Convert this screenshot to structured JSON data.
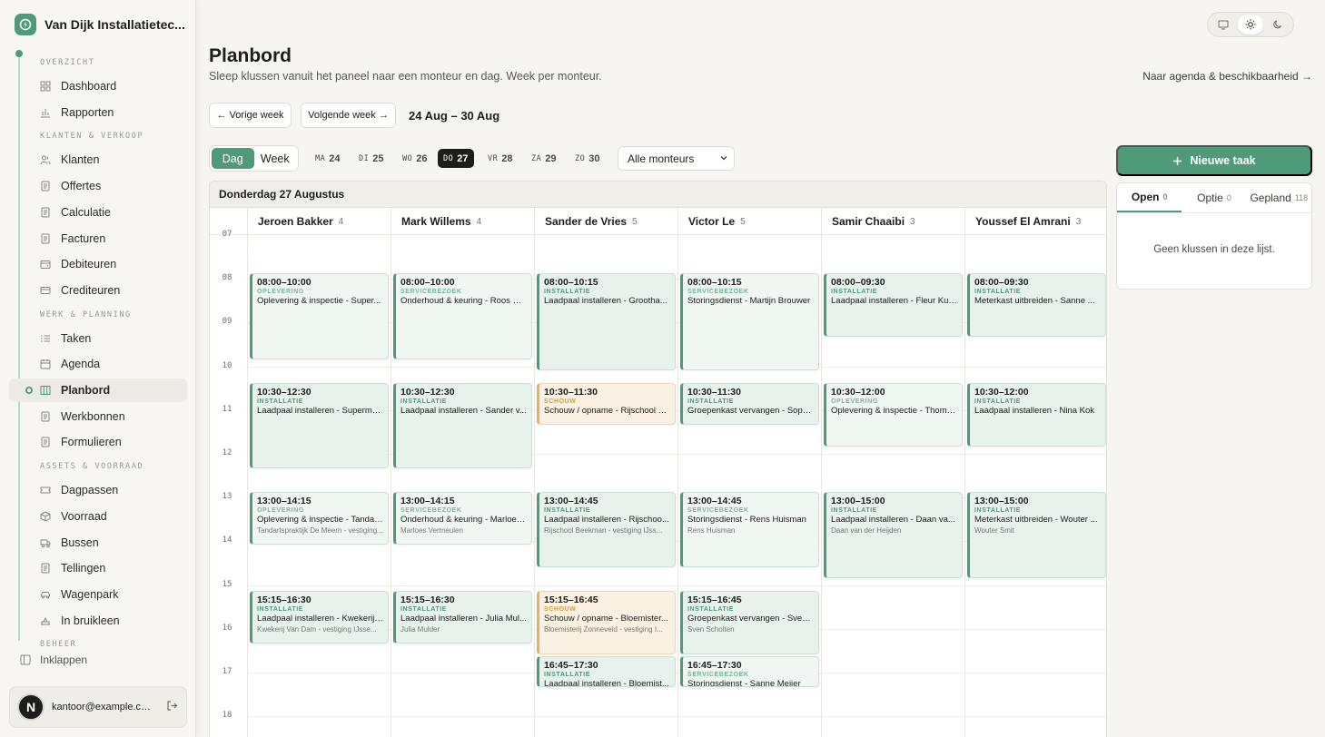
{
  "sidebar": {
    "company": "Van Dijk Installatietec...",
    "sections": [
      {
        "title": "OVERZICHT",
        "items": [
          {
            "label": "Dashboard",
            "icon": "dashboard-icon"
          },
          {
            "label": "Rapporten",
            "icon": "bar-chart-icon"
          }
        ]
      },
      {
        "title": "KLANTEN & VERKOOP",
        "items": [
          {
            "label": "Klanten",
            "icon": "users-icon"
          },
          {
            "label": "Offertes",
            "icon": "document-icon"
          },
          {
            "label": "Calculatie",
            "icon": "calculator-icon"
          },
          {
            "label": "Facturen",
            "icon": "invoice-icon"
          },
          {
            "label": "Debiteuren",
            "icon": "wallet-icon"
          },
          {
            "label": "Crediteuren",
            "icon": "card-icon"
          }
        ]
      },
      {
        "title": "WERK & PLANNING",
        "items": [
          {
            "label": "Taken",
            "icon": "list-icon"
          },
          {
            "label": "Agenda",
            "icon": "calendar-icon"
          },
          {
            "label": "Planbord",
            "icon": "columns-icon",
            "active": true
          },
          {
            "label": "Werkbonnen",
            "icon": "clipboard-icon"
          },
          {
            "label": "Formulieren",
            "icon": "form-icon"
          }
        ]
      },
      {
        "title": "ASSETS & VOORRAAD",
        "items": [
          {
            "label": "Dagpassen",
            "icon": "ticket-icon"
          },
          {
            "label": "Voorraad",
            "icon": "box-icon"
          },
          {
            "label": "Bussen",
            "icon": "van-icon"
          },
          {
            "label": "Tellingen",
            "icon": "checklist-icon"
          },
          {
            "label": "Wagenpark",
            "icon": "car-icon"
          },
          {
            "label": "In bruikleen",
            "icon": "handover-icon"
          }
        ]
      },
      {
        "title": "BEHEER",
        "items": []
      }
    ],
    "collapse_label": "Inklappen",
    "user": {
      "initial": "N",
      "email": "kantoor@example.co..."
    }
  },
  "header": {
    "title": "Planbord",
    "subtitle": "Sleep klussen vanuit het paneel naar een monteur en dag. Week per monteur.",
    "agenda_link": "Naar agenda & beschikbaarheid →"
  },
  "nav": {
    "prev": "← Vorige week",
    "next": "Volgende week →",
    "range": "24 Aug – 30 Aug"
  },
  "view_toggle": {
    "day": "Dag",
    "week": "Week"
  },
  "days": [
    {
      "name": "MA",
      "num": "24"
    },
    {
      "name": "DI",
      "num": "25"
    },
    {
      "name": "WO",
      "num": "26"
    },
    {
      "name": "DO",
      "num": "27",
      "active": true
    },
    {
      "name": "VR",
      "num": "28"
    },
    {
      "name": "ZA",
      "num": "29"
    },
    {
      "name": "ZO",
      "num": "30"
    }
  ],
  "filter": {
    "selected": "Alle monteurs"
  },
  "board": {
    "date_title": "Donderdag 27 Augustus",
    "hours": [
      "07",
      "08",
      "09",
      "10",
      "11",
      "12",
      "13",
      "14",
      "15",
      "16",
      "17",
      "18"
    ],
    "columns": [
      {
        "name": "Jeroen Bakker",
        "count": "4",
        "jobs": [
          {
            "time": "08:00–10:00",
            "start": 8,
            "end": 10,
            "type": "OPLEVERING",
            "variant": "light",
            "title": "Oplevering & inspectie - Super...",
            "sub": ""
          },
          {
            "time": "10:30–12:30",
            "start": 10.5,
            "end": 12.5,
            "type": "INSTALLATIE",
            "variant": "install",
            "title": "Laadpaal installeren - Superma...",
            "sub": ""
          },
          {
            "time": "13:00–14:15",
            "start": 13,
            "end": 14.25,
            "type": "OPLEVERING",
            "variant": "light",
            "title": "Oplevering & inspectie - Tandar...",
            "sub": "Tandartspraktijk De Meern - vestiging..."
          },
          {
            "time": "15:15–16:30",
            "start": 15.25,
            "end": 16.5,
            "type": "INSTALLATIE",
            "variant": "install",
            "title": "Laadpaal installeren - Kwekerij ...",
            "sub": "Kwekerij Van Dam - vestiging IJsse..."
          }
        ]
      },
      {
        "name": "Mark Willems",
        "count": "4",
        "jobs": [
          {
            "time": "08:00–10:00",
            "start": 8,
            "end": 10,
            "type": "SERVICEBEZOEK",
            "variant": "light",
            "title": "Onderhoud & keuring - Roos He...",
            "sub": ""
          },
          {
            "time": "10:30–12:30",
            "start": 10.5,
            "end": 12.5,
            "type": "INSTALLATIE",
            "variant": "install",
            "title": "Laadpaal installeren - Sander v...",
            "sub": ""
          },
          {
            "time": "13:00–14:15",
            "start": 13,
            "end": 14.25,
            "type": "SERVICEBEZOEK",
            "variant": "light",
            "title": "Onderhoud & keuring - Marloes...",
            "sub": "Marloes Vermeulen"
          },
          {
            "time": "15:15–16:30",
            "start": 15.25,
            "end": 16.5,
            "type": "INSTALLATIE",
            "variant": "install",
            "title": "Laadpaal installeren - Julia Mul...",
            "sub": "Julia Mulder"
          }
        ]
      },
      {
        "name": "Sander de Vries",
        "count": "5",
        "jobs": [
          {
            "time": "08:00–10:15",
            "start": 8,
            "end": 10.25,
            "type": "INSTALLATIE",
            "variant": "install",
            "title": "Laadpaal installeren - Grootha...",
            "sub": ""
          },
          {
            "time": "10:30–11:30",
            "start": 10.5,
            "end": 11.5,
            "type": "SCHOUW",
            "variant": "schouw",
            "title": "Schouw / opname - Rijschool B...",
            "sub": ""
          },
          {
            "time": "13:00–14:45",
            "start": 13,
            "end": 14.75,
            "type": "INSTALLATIE",
            "variant": "install",
            "title": "Laadpaal installeren - Rijschoo...",
            "sub": "Rijschool Beekman - vestiging IJss..."
          },
          {
            "time": "15:15–16:45",
            "start": 15.25,
            "end": 16.75,
            "type": "SCHOUW",
            "variant": "schouw",
            "title": "Schouw / opname - Bloemister...",
            "sub": "Bloemisterij Zonneveld - vestiging I..."
          },
          {
            "time": "16:45–17:30",
            "start": 16.75,
            "end": 17.5,
            "type": "INSTALLATIE",
            "variant": "install",
            "title": "Laadpaal installeren - Bloemist...",
            "sub": ""
          }
        ]
      },
      {
        "name": "Victor Le",
        "count": "5",
        "jobs": [
          {
            "time": "08:00–10:15",
            "start": 8,
            "end": 10.25,
            "type": "SERVICEBEZOEK",
            "variant": "light",
            "title": "Storingsdienst - Martijn Brouwer",
            "sub": ""
          },
          {
            "time": "10:30–11:30",
            "start": 10.5,
            "end": 11.5,
            "type": "INSTALLATIE",
            "variant": "install",
            "title": "Groepenkast vervangen - Soph...",
            "sub": ""
          },
          {
            "time": "13:00–14:45",
            "start": 13,
            "end": 14.75,
            "type": "SERVICEBEZOEK",
            "variant": "light",
            "title": "Storingsdienst - Rens Huisman",
            "sub": "Rens Huisman"
          },
          {
            "time": "15:15–16:45",
            "start": 15.25,
            "end": 16.75,
            "type": "INSTALLATIE",
            "variant": "install",
            "title": "Groepenkast vervangen - Sven ...",
            "sub": "Sven Scholten"
          },
          {
            "time": "16:45–17:30",
            "start": 16.75,
            "end": 17.5,
            "type": "SERVICEBEZOEK",
            "variant": "light",
            "title": "Storingsdienst - Sanne Meijer",
            "sub": ""
          }
        ]
      },
      {
        "name": "Samir Chaaibi",
        "count": "3",
        "jobs": [
          {
            "time": "08:00–09:30",
            "start": 8,
            "end": 9.5,
            "type": "INSTALLATIE",
            "variant": "install",
            "title": "Laadpaal installeren - Fleur Kui...",
            "sub": ""
          },
          {
            "time": "10:30–12:00",
            "start": 10.5,
            "end": 12,
            "type": "OPLEVERING",
            "variant": "light",
            "title": "Oplevering & inspectie - Thoma...",
            "sub": ""
          },
          {
            "time": "13:00–15:00",
            "start": 13,
            "end": 15,
            "type": "INSTALLATIE",
            "variant": "install",
            "title": "Laadpaal installeren - Daan va...",
            "sub": "Daan van der Heijden"
          }
        ]
      },
      {
        "name": "Youssef El Amrani",
        "count": "3",
        "jobs": [
          {
            "time": "08:00–09:30",
            "start": 8,
            "end": 9.5,
            "type": "INSTALLATIE",
            "variant": "install",
            "title": "Meterkast uitbreiden - Sanne ...",
            "sub": ""
          },
          {
            "time": "10:30–12:00",
            "start": 10.5,
            "end": 12,
            "type": "INSTALLATIE",
            "variant": "install",
            "title": "Laadpaal installeren - Nina Kok",
            "sub": ""
          },
          {
            "time": "13:00–15:00",
            "start": 13,
            "end": 15,
            "type": "INSTALLATIE",
            "variant": "install",
            "title": "Meterkast uitbreiden - Wouter ...",
            "sub": "Wouter Smit"
          }
        ]
      }
    ]
  },
  "panel": {
    "new_task": "Nieuwe taak",
    "tabs": [
      {
        "label": "Open",
        "count": "0",
        "active": true
      },
      {
        "label": "Optie",
        "count": "0"
      },
      {
        "label": "Gepland",
        "count": "118"
      }
    ],
    "empty": "Geen klussen in deze lijst."
  }
}
